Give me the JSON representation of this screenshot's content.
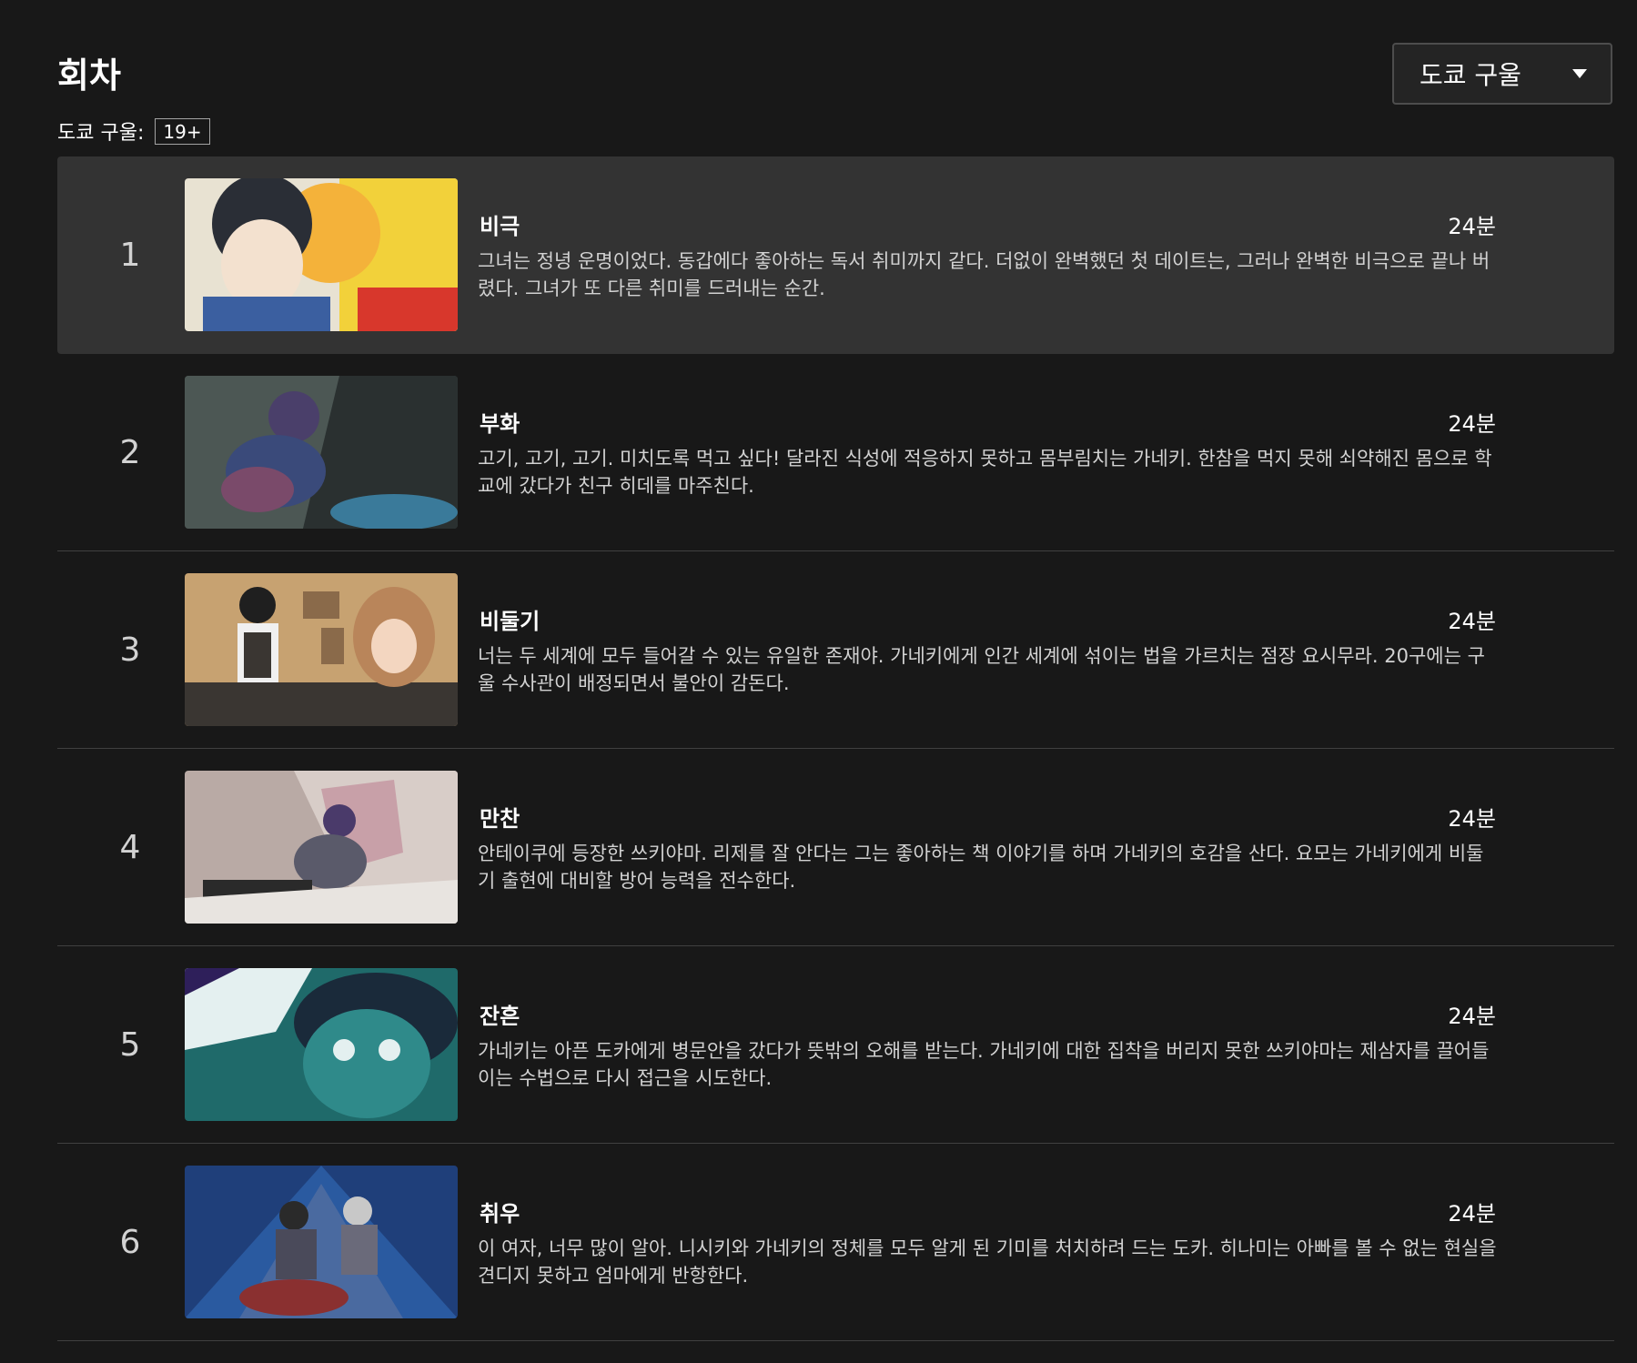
{
  "header": {
    "title": "회차",
    "season_selector": "도쿄 구울"
  },
  "show": {
    "label": "도쿄 구울:",
    "rating": "19+"
  },
  "episodes": [
    {
      "number": "1",
      "title": "비극",
      "duration": "24분",
      "description": "그녀는 정녕 운명이었다. 동갑에다 좋아하는 독서 취미까지 같다. 더없이 완벽했던 첫 데이트는, 그러나 완벽한 비극으로 끝나 버렸다. 그녀가 또 다른 취미를 드러내는 순간.",
      "thumb_colors": [
        "#f4b23a",
        "#3b3f4a",
        "#e8e2d2"
      ]
    },
    {
      "number": "2",
      "title": "부화",
      "duration": "24분",
      "description": "고기, 고기, 고기. 미치도록 먹고 싶다! 달라진 식성에 적응하지 못하고 몸부림치는 가네키. 한참을 먹지 못해 쇠약해진 몸으로 학교에 갔다가 친구 히데를 마주친다.",
      "thumb_colors": [
        "#3e4a4a",
        "#5b4a6a",
        "#2a3030"
      ]
    },
    {
      "number": "3",
      "title": "비둘기",
      "duration": "24분",
      "description": "너는 두 세계에 모두 들어갈 수 있는 유일한 존재야. 가네키에게 인간 세계에 섞이는 법을 가르치는 점장 요시무라. 20구에는 구울 수사관이 배정되면서 불안이 감돈다.",
      "thumb_colors": [
        "#c7a271",
        "#3a3632",
        "#b9855a"
      ]
    },
    {
      "number": "4",
      "title": "만찬",
      "duration": "24분",
      "description": "안테이쿠에 등장한 쓰키야마. 리제를 잘 안다는 그는 좋아하는 책 이야기를 하며 가네키의 호감을 산다. 요모는 가네키에게 비둘기 출현에 대비할 방어 능력을 전수한다.",
      "thumb_colors": [
        "#b9aaa5",
        "#5a5a6a",
        "#d8cdc8"
      ]
    },
    {
      "number": "5",
      "title": "잔흔",
      "duration": "24분",
      "description": "가네키는 아픈 도카에게 병문안을 갔다가 뜻밖의 오해를 받는다. 가네키에 대한 집착을 버리지 못한 쓰키야마는 제삼자를 끌어들이는 수법으로 다시 접근을 시도한다.",
      "thumb_colors": [
        "#1f6a6a",
        "#2e1f5a",
        "#e4f0f0"
      ]
    },
    {
      "number": "6",
      "title": "취우",
      "duration": "24분",
      "description": "이 여자, 너무 많이 알아. 니시키와 가네키의 정체를 모두 알게 된 기미를 처치하려 드는 도카. 히나미는 아빠를 볼 수 없는 현실을 견디지 못하고 엄마에게 반항한다.",
      "thumb_colors": [
        "#1f3f7a",
        "#6a6a7a",
        "#8a3030"
      ]
    }
  ]
}
